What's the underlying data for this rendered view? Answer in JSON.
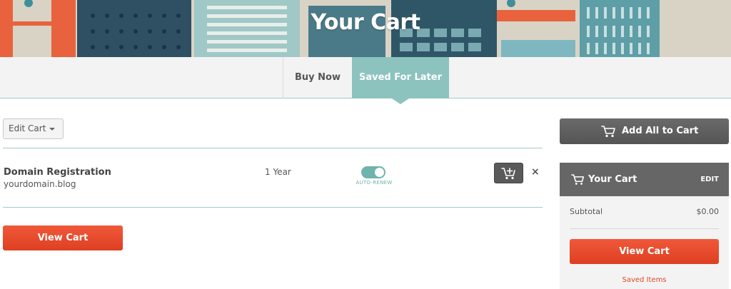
{
  "banner": {
    "title": "Your Cart"
  },
  "tabs": [
    {
      "label": "Buy Now",
      "active": false
    },
    {
      "label": "Saved For Later",
      "active": true
    }
  ],
  "edit_cart": {
    "label": "Edit Cart"
  },
  "item": {
    "name": "Domain Registration",
    "domain": "yourdomain.blog",
    "term": "1 Year",
    "auto_renew_label": "AUTO-RENEW",
    "auto_renew_on": true,
    "remove_glyph": "×"
  },
  "view_cart_main": {
    "label": "View Cart"
  },
  "sidebar": {
    "add_all_label": "Add All to Cart",
    "cart_title": "Your Cart",
    "edit_label": "EDIT",
    "subtotal_label": "Subtotal",
    "subtotal_value": "$0.00",
    "view_cart_label": "View Cart",
    "saved_items_label": "Saved Items"
  },
  "icons": [
    "cart-icon",
    "add-to-cart-icon",
    "close-icon",
    "dropdown-caret-icon"
  ],
  "colors": {
    "accent_teal": "#8cc3bf",
    "toggle_teal": "#6fb3ad",
    "primary_orange": "#e54a2c",
    "dark_gray": "#5a5a5a"
  }
}
